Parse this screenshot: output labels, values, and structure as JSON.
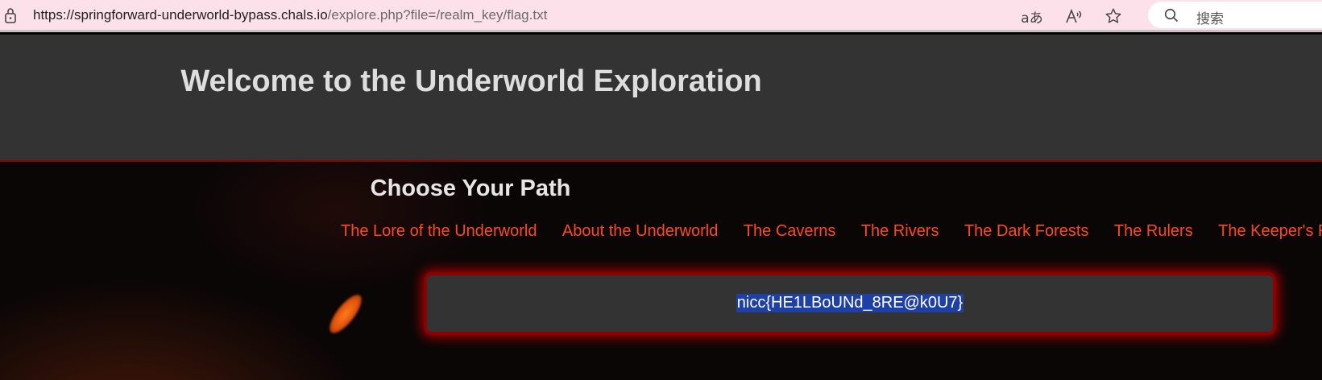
{
  "browser": {
    "url_host": "https://springforward-underworld-bypass.chals.io",
    "url_path": "/explore.php?file=/realm_key/flag.txt",
    "search_placeholder": "搜索",
    "translate_glyph": "aあ",
    "read_aloud_glyph": "A",
    "icons": [
      "lock-icon",
      "translate-icon",
      "read-aloud-icon",
      "favorite-icon",
      "search-icon"
    ]
  },
  "header": {
    "title": "Welcome to the Underworld Exploration"
  },
  "main": {
    "heading": "Choose Your Path",
    "nav": [
      {
        "label": "The Lore of the Underworld"
      },
      {
        "label": "About the Underworld"
      },
      {
        "label": "The Caverns"
      },
      {
        "label": "The Rivers"
      },
      {
        "label": "The Dark Forests"
      },
      {
        "label": "The Rulers"
      },
      {
        "label": "The Keeper's R"
      }
    ],
    "content": "nicc{HE1LBoUNd_8RE@k0U7}"
  },
  "colors": {
    "browser_bar": "#fde1ea",
    "header_bg": "#333333",
    "link": "#ff4a1c",
    "box_border": "#8b0000",
    "selection": "#1e3fa6"
  }
}
